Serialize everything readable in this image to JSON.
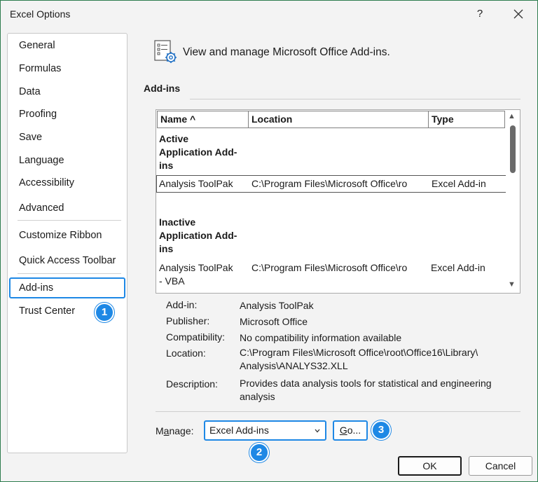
{
  "window": {
    "title": "Excel Options",
    "help_label": "?",
    "close_label": "✕"
  },
  "sidebar": {
    "items": [
      {
        "label": "General"
      },
      {
        "label": "Formulas"
      },
      {
        "label": "Data"
      },
      {
        "label": "Proofing"
      },
      {
        "label": "Save"
      },
      {
        "label": "Language"
      },
      {
        "label": "Accessibility"
      },
      {
        "label": "Advanced"
      },
      {
        "label": "Customize Ribbon"
      },
      {
        "label": "Quick Access Toolbar"
      },
      {
        "label": "Add-ins"
      },
      {
        "label": "Trust Center"
      }
    ],
    "selected": "Add-ins"
  },
  "badges": {
    "one": "1",
    "two": "2",
    "three": "3",
    "color": "#1e88e5"
  },
  "main": {
    "header_text": "View and manage Microsoft Office Add-ins.",
    "header_icon": "settings-list-icon",
    "section_title": "Add-ins",
    "table": {
      "columns": [
        "Name ^",
        "Location",
        "Type"
      ],
      "groups": [
        {
          "label_lines": [
            "Active",
            "Application Add-",
            "ins"
          ],
          "rows": [
            {
              "name": "Analysis ToolPak",
              "location": "C:\\Program Files\\Microsoft Office\\ro",
              "type": "Excel Add-in"
            }
          ]
        },
        {
          "label_lines": [
            "Inactive",
            "Application Add-",
            "ins"
          ],
          "rows": [
            {
              "name_lines": [
                "Analysis ToolPak",
                "- VBA"
              ],
              "location": "C:\\Program Files\\Microsoft Office\\ro",
              "type": "Excel Add-in"
            }
          ]
        }
      ]
    },
    "details": {
      "addin_label": "Add-in:",
      "addin_value": "Analysis ToolPak",
      "publisher_label": "Publisher:",
      "publisher_value": "Microsoft Office",
      "compat_label": "Compatibility:",
      "compat_value": "No compatibility information available",
      "location_label": "Location:",
      "location_value_lines": [
        "C:\\Program Files\\Microsoft Office\\root\\Office16\\Library\\",
        "Analysis\\ANALYS32.XLL"
      ],
      "description_label": "Description:",
      "description_value_lines": [
        "Provides data analysis tools for statistical and engineering",
        "analysis"
      ]
    },
    "manage": {
      "label_pre": "M",
      "label_acc": "a",
      "label_post": "nage:",
      "selected_value": "Excel Add-ins",
      "go_acc": "G",
      "go_post": "o..."
    }
  },
  "footer": {
    "ok_label": "OK",
    "cancel_label": "Cancel"
  }
}
